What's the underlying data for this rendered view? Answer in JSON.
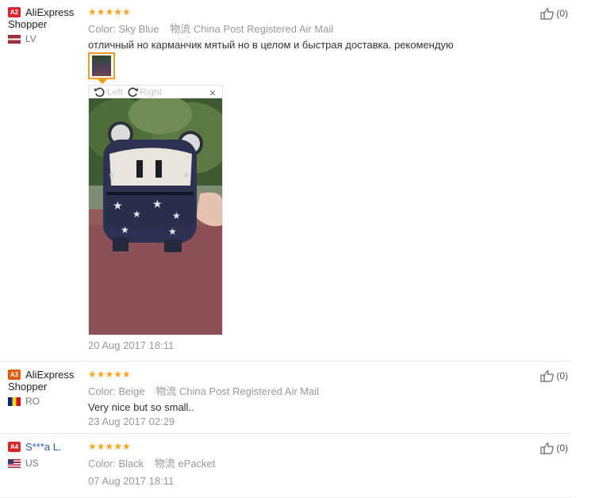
{
  "reviews": [
    {
      "badge": "A2",
      "name_line1": "AliExpress",
      "name_line2": "Shopper",
      "country": "LV",
      "rating_stars": "★★★★★",
      "color_label": "Color:",
      "color_value": "Sky Blue",
      "shipping_label": "物流",
      "shipping_value": "China Post Registered Air Mail",
      "text": "отличный но карманчик мятый но в целом и быстрая доставка. рекомендую",
      "date": "20 Aug 2017 18:11",
      "helpful": "(0)",
      "viewer": {
        "rotate_left": "Left",
        "rotate_right": "Right",
        "close": "×"
      }
    },
    {
      "badge": "A3",
      "name_line1": "AliExpress",
      "name_line2": "Shopper",
      "country": "RO",
      "rating_stars": "★★★★★",
      "color_label": "Color:",
      "color_value": "Beige",
      "shipping_label": "物流",
      "shipping_value": "China Post Registered Air Mail",
      "text": "Very nice but so small..",
      "date": "23 Aug 2017 02:29",
      "helpful": "(0)"
    },
    {
      "badge": "A4",
      "name_line1": "S***a L.",
      "country": "US",
      "rating_stars": "★★★★★",
      "color_label": "Color:",
      "color_value": "Black",
      "shipping_label": "物流",
      "shipping_value": "ePacket",
      "date": "07 Aug 2017 18:11",
      "helpful": "(0)"
    }
  ],
  "icons": {
    "thumbs_up": "thumbs-up-icon",
    "rotate_left": "rotate-left-icon",
    "rotate_right": "rotate-right-icon",
    "close": "close-icon"
  },
  "colors": {
    "star": "#f5a623",
    "thumb_border": "#f39c1f",
    "badge_red": "#d8262c",
    "badge_orange": "#e05d10"
  }
}
